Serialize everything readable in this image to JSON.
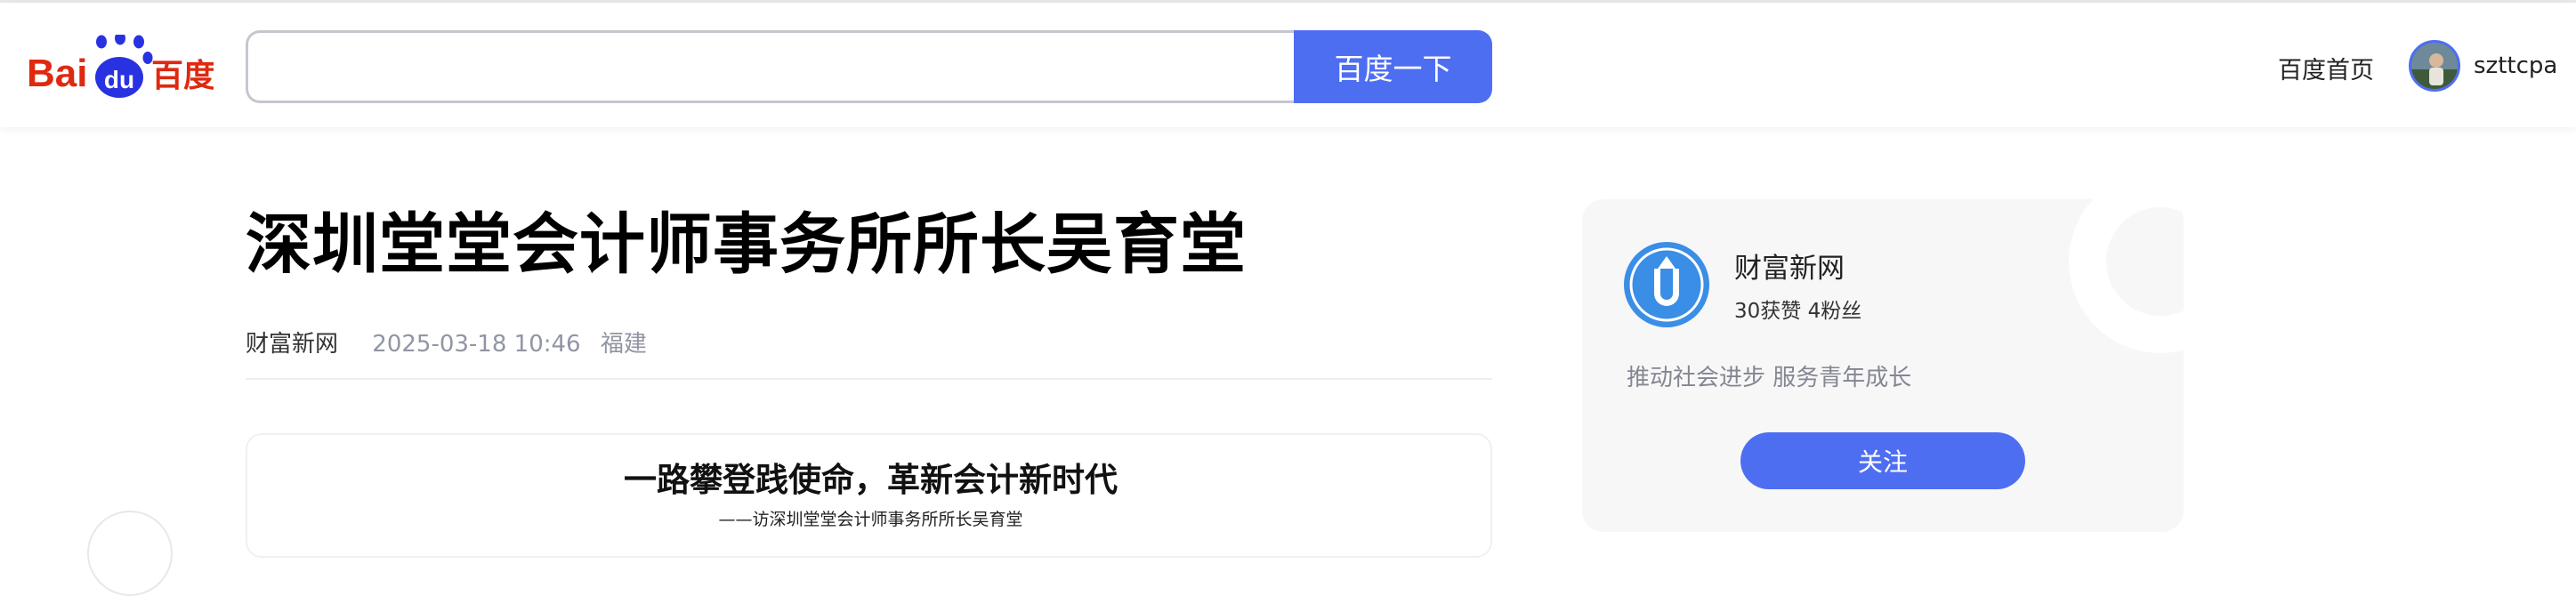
{
  "header": {
    "logo": {
      "text_left": "Bai",
      "text_paw": "du",
      "text_right": "百度",
      "colors": {
        "red": "#de2910",
        "blue": "#2932e1"
      }
    },
    "search": {
      "value": "",
      "placeholder": "",
      "button_label": "百度一下"
    },
    "home_link": "百度首页",
    "user": {
      "name": "szttcpa",
      "avatar_icon": "user-avatar-icon"
    }
  },
  "article": {
    "title": "深圳堂堂会计师事务所所长吴育堂",
    "author": "财富新网",
    "date": "2025-03-18 10:46",
    "location": "福建",
    "card_heading": "一路攀登践使命，革新会计新时代",
    "card_subheading": "——访深圳堂堂会计师事务所所长吴育堂"
  },
  "author_card": {
    "name": "财富新网",
    "stats": "30获赞 4粉丝",
    "description": "推动社会进步 服务青年成长",
    "follow_label": "关注"
  },
  "colors": {
    "accent": "#4e6ef2",
    "muted_text": "#9195a3",
    "card_bg": "#f7f7f8"
  }
}
